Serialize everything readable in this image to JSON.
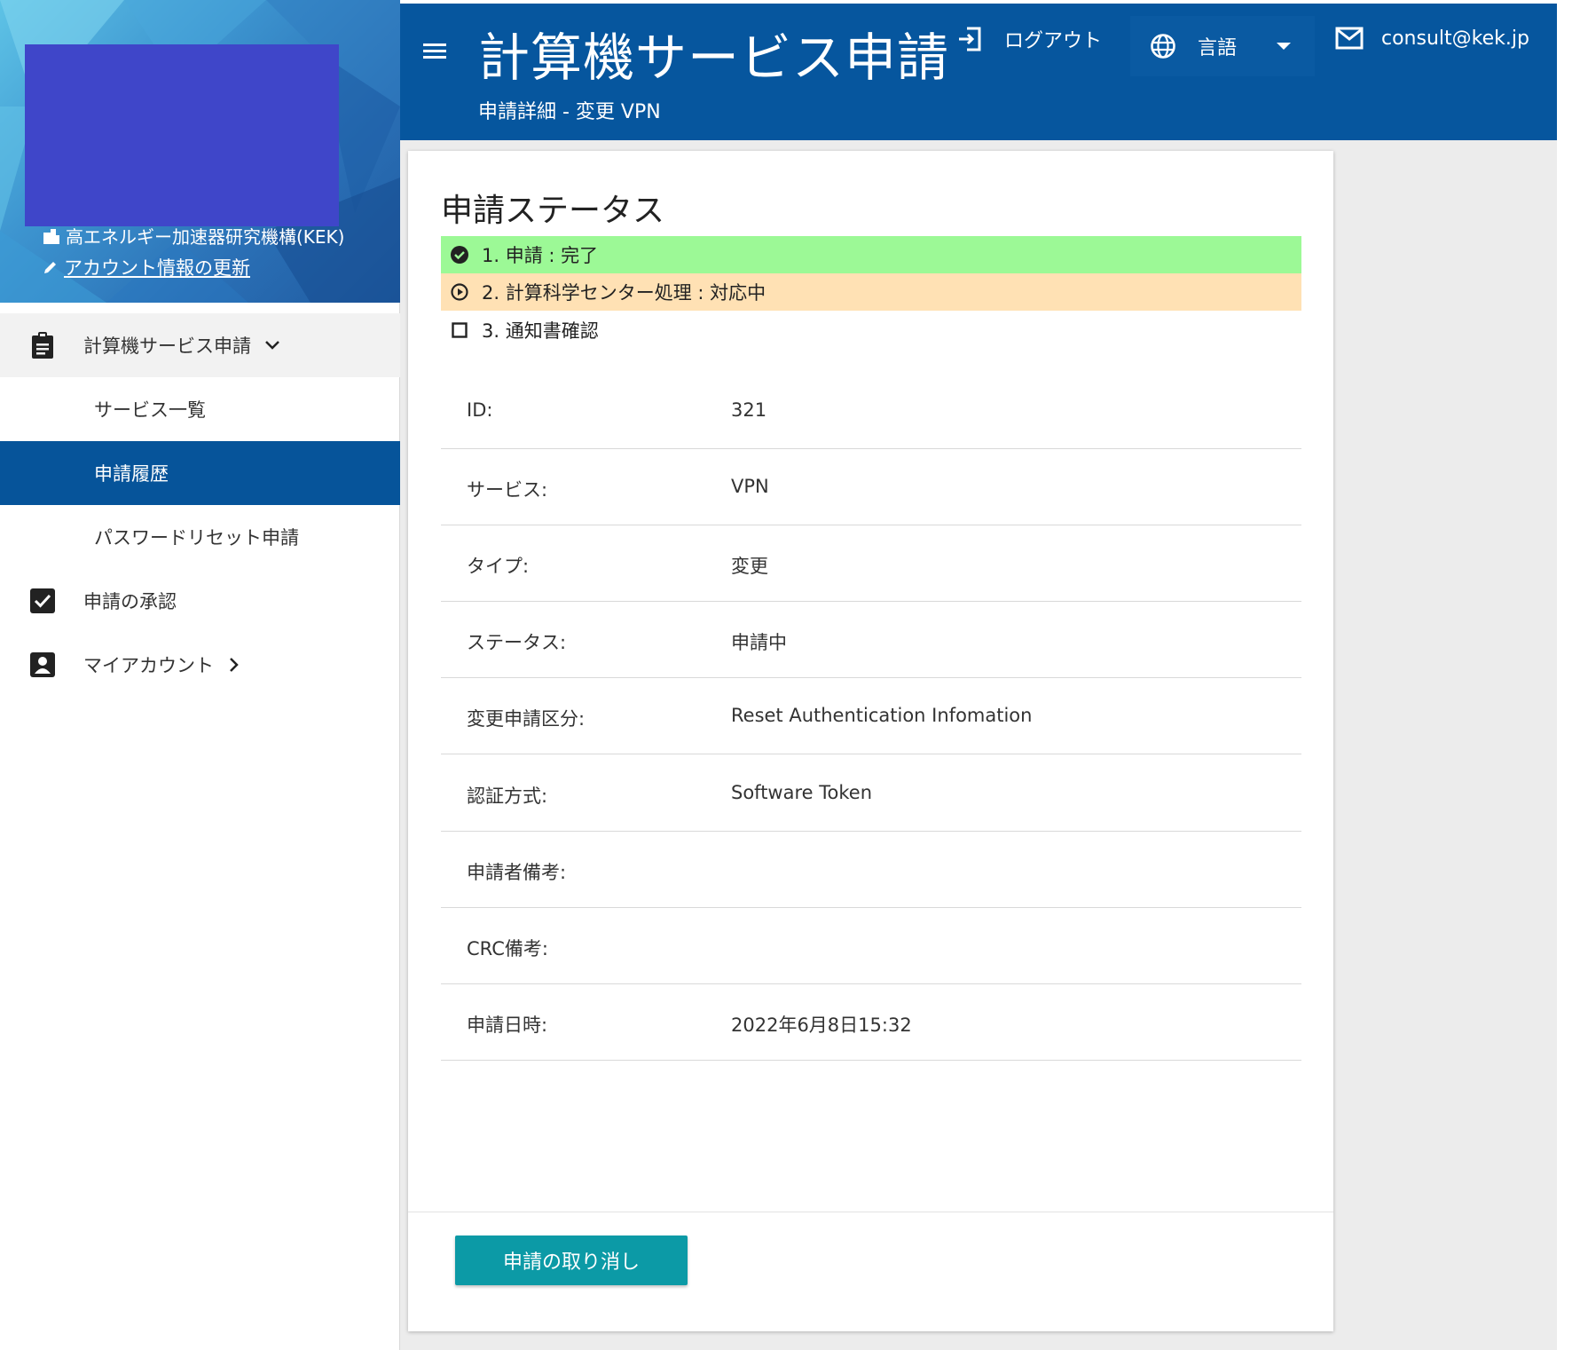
{
  "sidebar": {
    "org_name": "高エネルギー加速器研究機構(KEK)",
    "account_update_link": "アカウント情報の更新",
    "nav": {
      "service_request": "計算機サービス申請",
      "service_list": "サービス一覧",
      "request_history": "申請履歴",
      "password_reset": "パスワードリセット申請",
      "approval": "申請の承認",
      "my_account": "マイアカウント"
    },
    "icons": {
      "org": "building-icon",
      "edit": "pencil-icon",
      "service_request": "clipboard-icon",
      "expand": "chevron-down-icon",
      "approval": "checkbox-checked-icon",
      "my_account": "account-box-icon",
      "my_account_expand": "chevron-right-icon"
    }
  },
  "header": {
    "title": "計算機サービス申請",
    "subtitle": "申請詳細 - 変更 VPN",
    "logout": "ログアウト",
    "language": "言語",
    "email": "consult@kek.jp"
  },
  "status": {
    "title": "申請ステータス",
    "steps": [
      {
        "label": "1. 申請 : 完了",
        "state": "done",
        "color": "#9cf996"
      },
      {
        "label": "2. 計算科学センター処理 : 対応中",
        "state": "in-progress",
        "color": "#ffe1b4"
      },
      {
        "label": "3. 通知書確認",
        "state": "pending",
        "color": "#ffffff"
      }
    ]
  },
  "details": [
    {
      "key": "ID:",
      "value": "321"
    },
    {
      "key": "サービス:",
      "value": "VPN"
    },
    {
      "key": "タイプ:",
      "value": "変更"
    },
    {
      "key": "ステータス:",
      "value": "申請中"
    },
    {
      "key": "変更申請区分:",
      "value": "Reset Authentication Infomation"
    },
    {
      "key": "認証方式:",
      "value": "Software Token"
    },
    {
      "key": "申請者備考:",
      "value": ""
    },
    {
      "key": "CRC備考:",
      "value": ""
    },
    {
      "key": "申請日時:",
      "value": "2022年6月8日15:32"
    }
  ],
  "actions": {
    "cancel": "申請の取り消し"
  },
  "colors": {
    "header": "#06569e",
    "active_nav": "#06549a",
    "cancel_button": "#0c9aa6",
    "avatar": "#3f46c9"
  }
}
